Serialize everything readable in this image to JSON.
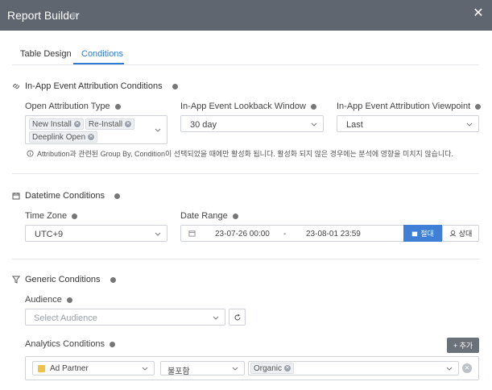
{
  "window": {
    "title": "Report Builder"
  },
  "tabs": [
    {
      "label": "Table Design",
      "active": false
    },
    {
      "label": "Conditions",
      "active": true
    }
  ],
  "attribution": {
    "title": "In-App Event Attribution Conditions",
    "open_type_label": "Open Attribution Type",
    "open_type_tags": [
      "New Install",
      "Re-Install",
      "Deeplink Open"
    ],
    "lookback_label": "In-App Event Lookback Window",
    "lookback_value": "30 day",
    "viewpoint_label": "In-App Event Attribution Viewpoint",
    "viewpoint_value": "Last",
    "hint": "Attribution과 관련된 Group By, Condition이 선택되었을 때에만 활성화 됩니다. 활성화 되지 않은 경우에는 분석에 영향을 미치지 않습니다."
  },
  "datetime": {
    "title": "Datetime Conditions",
    "timezone_label": "Time Zone",
    "timezone_value": "UTC+9",
    "daterange_label": "Date Range",
    "date_start": "23-07-26 00:00",
    "date_sep": "-",
    "date_end": "23-08-01 23:59",
    "absolute_label": "절대",
    "relative_label": "상대"
  },
  "generic": {
    "title": "Generic Conditions",
    "audience_label": "Audience",
    "audience_placeholder": "Select Audience",
    "analytics_label": "Analytics Conditions",
    "add_label": "+ 추가",
    "condition": {
      "field": "Ad Partner",
      "operator": "불포함",
      "values": [
        "Organic"
      ]
    }
  },
  "colors": {
    "accent": "#2f7ad3",
    "titlebar": "#5f6670",
    "primary_button": "#3f7fd6"
  }
}
